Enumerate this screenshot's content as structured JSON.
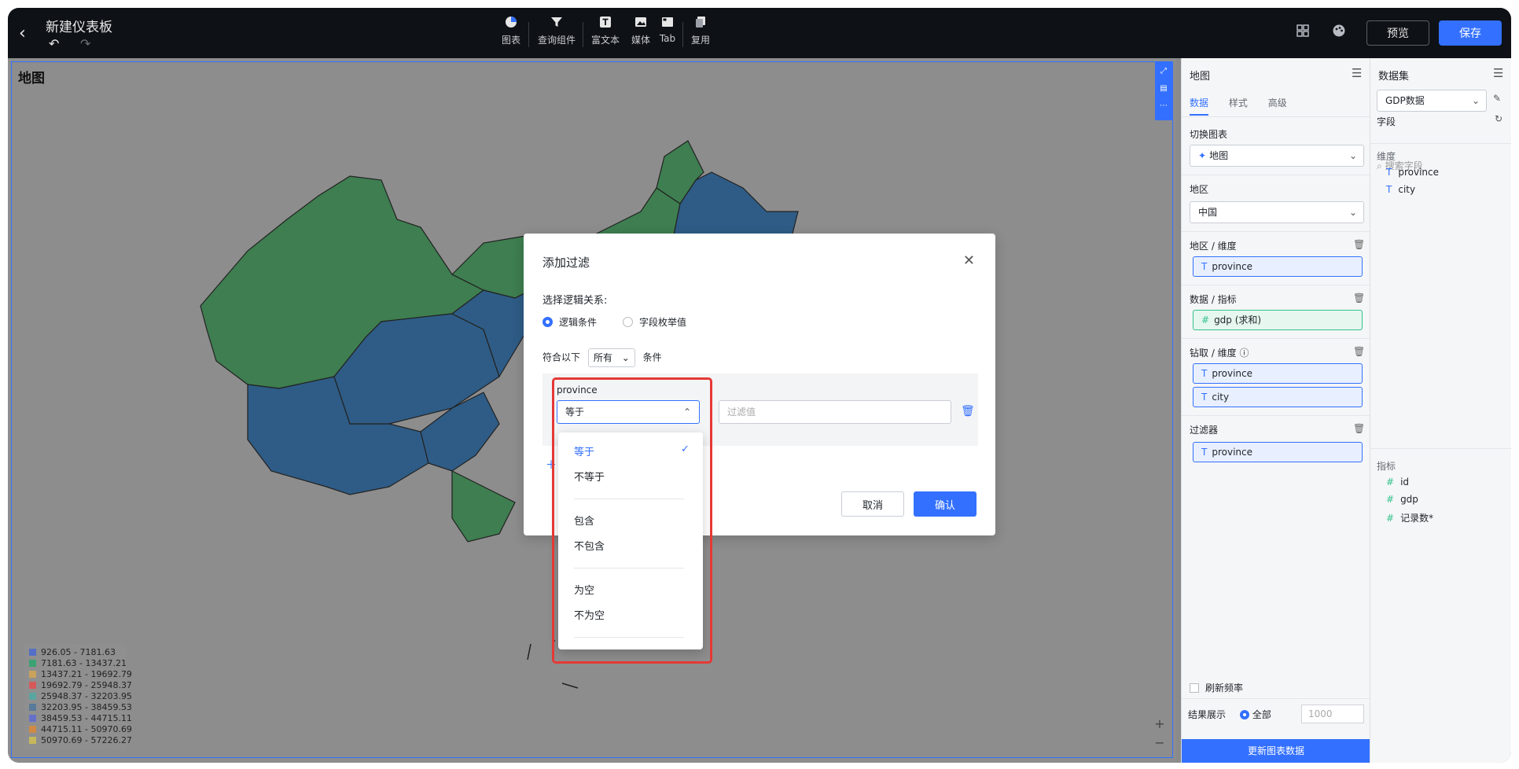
{
  "topbar": {
    "back_icon": "‹",
    "title": "新建仪表板",
    "undo_icon": "↶",
    "redo_icon": "↷",
    "tools": [
      {
        "icon": "chart-icon",
        "label": "图表"
      },
      {
        "icon": "filter-icon",
        "label": "查询组件"
      },
      {
        "icon": "text-icon",
        "label": "富文本"
      },
      {
        "icon": "media-icon",
        "label": "媒体"
      },
      {
        "icon": "tab-icon",
        "label": "Tab"
      },
      {
        "icon": "reuse-icon",
        "label": "复用"
      }
    ],
    "preview_label": "预览",
    "save_label": "保存"
  },
  "canvas": {
    "chart_title": "地图",
    "legend": [
      {
        "range": "926.05 - 7181.63",
        "color": "#5470c6"
      },
      {
        "range": "7181.63 - 13437.21",
        "color": "#3ba272"
      },
      {
        "range": "13437.21 - 19692.79",
        "color": "#c9a25b"
      },
      {
        "range": "19692.79 - 25948.37",
        "color": "#d65a5a"
      },
      {
        "range": "25948.37 - 32203.95",
        "color": "#59a6a0"
      },
      {
        "range": "32203.95 - 38459.53",
        "color": "#5a7a9a"
      },
      {
        "range": "38459.53 - 44715.11",
        "color": "#6670c9"
      },
      {
        "range": "44715.11 - 50970.69",
        "color": "#d08a45"
      },
      {
        "range": "50970.69 - 57226.27",
        "color": "#c6b85a"
      }
    ],
    "zoom_in": "+",
    "zoom_out": "−"
  },
  "panel": {
    "title": "地图",
    "tabs": [
      "数据",
      "样式",
      "高级"
    ],
    "switch_chart_label": "切换图表",
    "chart_type_value": "地图",
    "region_label": "地区",
    "region_value": "中国",
    "region_dim_label": "地区 / 维度",
    "region_dim_chip": "province",
    "metric_label": "数据 / 指标",
    "metric_chip": "gdp (求和)",
    "drill_label": "钻取 / 维度",
    "drill_chips": [
      "province",
      "city"
    ],
    "filter_label": "过滤器",
    "filter_chip": "province",
    "refresh_label": "刷新频率",
    "result_label": "结果展示",
    "result_all": "全部",
    "result_count": "1000",
    "update_button": "更新图表数据"
  },
  "dataset": {
    "title": "数据集",
    "dataset_value": "GDP数据",
    "field_label": "字段",
    "search_placeholder": "搜索字段",
    "dimension_label": "维度",
    "dimensions": [
      "province",
      "city"
    ],
    "metric_label": "指标",
    "metrics": [
      "id",
      "gdp",
      "记录数*"
    ]
  },
  "dialog": {
    "title": "添加过滤",
    "logic_label": "选择逻辑关系:",
    "radio_logic": "逻辑条件",
    "radio_enum": "字段枚举值",
    "match_prefix": "符合以下",
    "match_value": "所有",
    "match_suffix": "条件",
    "field_name": "province",
    "operator_value": "等于",
    "value_placeholder": "过滤值",
    "cancel_label": "取消",
    "confirm_label": "确认"
  },
  "dropdown": {
    "options": [
      "等于",
      "不等于",
      "包含",
      "不包含",
      "为空",
      "不为空"
    ],
    "selected": "等于"
  }
}
